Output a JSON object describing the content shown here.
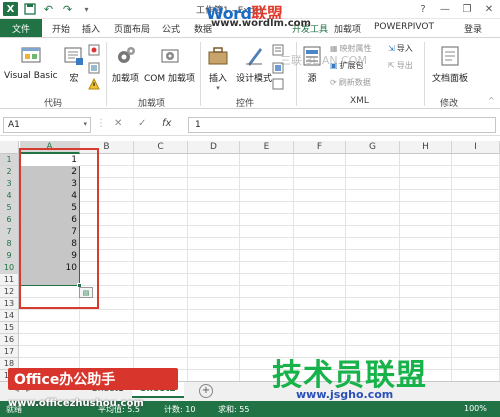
{
  "titlebar": {
    "title": "工作簿1 - Excel",
    "watermark_word": "Word",
    "watermark_lianmeng": "联盟",
    "watermark_url": "www.wordlm.com",
    "min": "—",
    "restore": "❐",
    "close": "✕"
  },
  "tabs": {
    "file": "文件",
    "items": [
      "开始",
      "插入",
      "页面布局",
      "公式",
      "数据",
      "加载项",
      "POWERPIVOT"
    ],
    "dev": "开发工具",
    "login": "登录"
  },
  "ribbon": {
    "code": {
      "visual_basic": "Visual Basic",
      "macro": "宏",
      "label": "代码"
    },
    "addins": {
      "addin": "加载项",
      "com_addin": "COM 加载项",
      "label": "加载项"
    },
    "controls": {
      "insert": "插入",
      "design_mode": "设计模式",
      "label": "控件"
    },
    "xml": {
      "source": "源",
      "map_properties": "映射属性",
      "expansion_pack": "扩展包",
      "refresh_data": "刷新数据",
      "import": "导入",
      "export": "导出",
      "label": "XML"
    },
    "modify": {
      "doc_panel": "文档面板",
      "label": "修改"
    }
  },
  "formula_bar": {
    "name_box": "A1",
    "cancel": "✕",
    "enter": "✓",
    "fx": "fx",
    "value": "1"
  },
  "columns": [
    "A",
    "B",
    "C",
    "D",
    "E",
    "F",
    "G",
    "H",
    "I"
  ],
  "rows": [
    "1",
    "2",
    "3",
    "4",
    "5",
    "6",
    "7",
    "8",
    "9",
    "10",
    "11",
    "12",
    "13",
    "14",
    "15",
    "16",
    "17",
    "18",
    "19"
  ],
  "cells_a": [
    "1",
    "2",
    "3",
    "4",
    "5",
    "6",
    "7",
    "8",
    "9",
    "10"
  ],
  "sheets": {
    "sheet1": "Sheet1",
    "sheet2": "Sheet2",
    "add": "+"
  },
  "status": {
    "ready": "就绪",
    "average": "平均值: 5.5",
    "count": "计数: 10",
    "sum": "求和: 55",
    "zoom": "100%"
  },
  "watermarks": {
    "office": "Office办公助手",
    "office_url": "www.officezhushou.com",
    "jishu": "技术员联盟",
    "jsgho": "www.jsgho.com",
    "sanlian": "三联 3LIAN.COM"
  },
  "colors": {
    "excel_green": "#217346",
    "selection_border": "#217346",
    "annotation_red": "#d63b2f"
  }
}
